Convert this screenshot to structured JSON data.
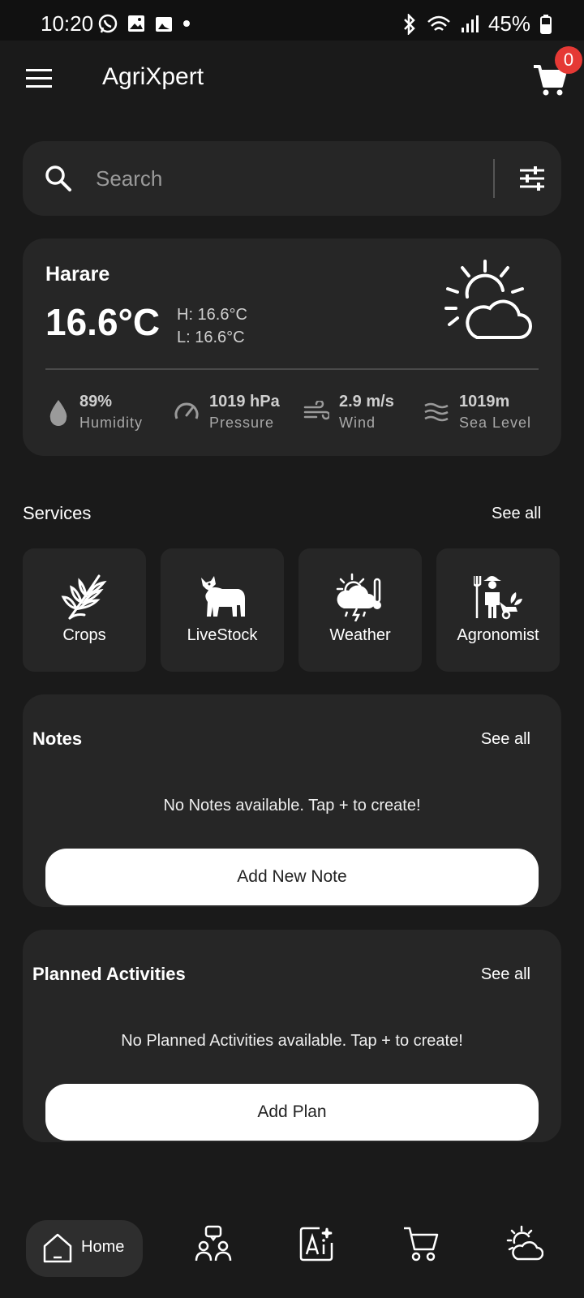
{
  "status_bar": {
    "time": "10:20",
    "battery": "45%"
  },
  "app": {
    "title": "AgriXpert",
    "cart_count": "0"
  },
  "search": {
    "placeholder": "Search"
  },
  "weather": {
    "city": "Harare",
    "temperature": "16.6°C",
    "high": "H: 16.6°C",
    "low": "L: 16.6°C",
    "stats": [
      {
        "value": "89%",
        "label": "Humidity",
        "icon": "drop-icon"
      },
      {
        "value": "1019 hPa",
        "label": "Pressure",
        "icon": "gauge-icon"
      },
      {
        "value": "2.9 m/s",
        "label": "Wind",
        "icon": "wind-icon"
      },
      {
        "value": "1019m",
        "label": "Sea Level",
        "icon": "waves-icon"
      }
    ]
  },
  "services": {
    "title": "Services",
    "see_all": "See all",
    "items": [
      {
        "label": "Crops",
        "icon": "wheat-icon"
      },
      {
        "label": "LiveStock",
        "icon": "cow-icon"
      },
      {
        "label": "Weather",
        "icon": "storm-icon"
      },
      {
        "label": "Agronomist",
        "icon": "farmer-icon"
      }
    ]
  },
  "notes": {
    "title": "Notes",
    "see_all": "See all",
    "empty": "No Notes available. Tap + to create!",
    "button": "Add New Note"
  },
  "activities": {
    "title": "Planned Activities",
    "see_all": "See all",
    "empty": "No Planned Activities available. Tap + to create!",
    "button": "Add Plan"
  },
  "bottom_nav": {
    "home": "Home",
    "items": [
      "community-icon",
      "ai-icon",
      "cart-icon",
      "weather-icon"
    ]
  }
}
